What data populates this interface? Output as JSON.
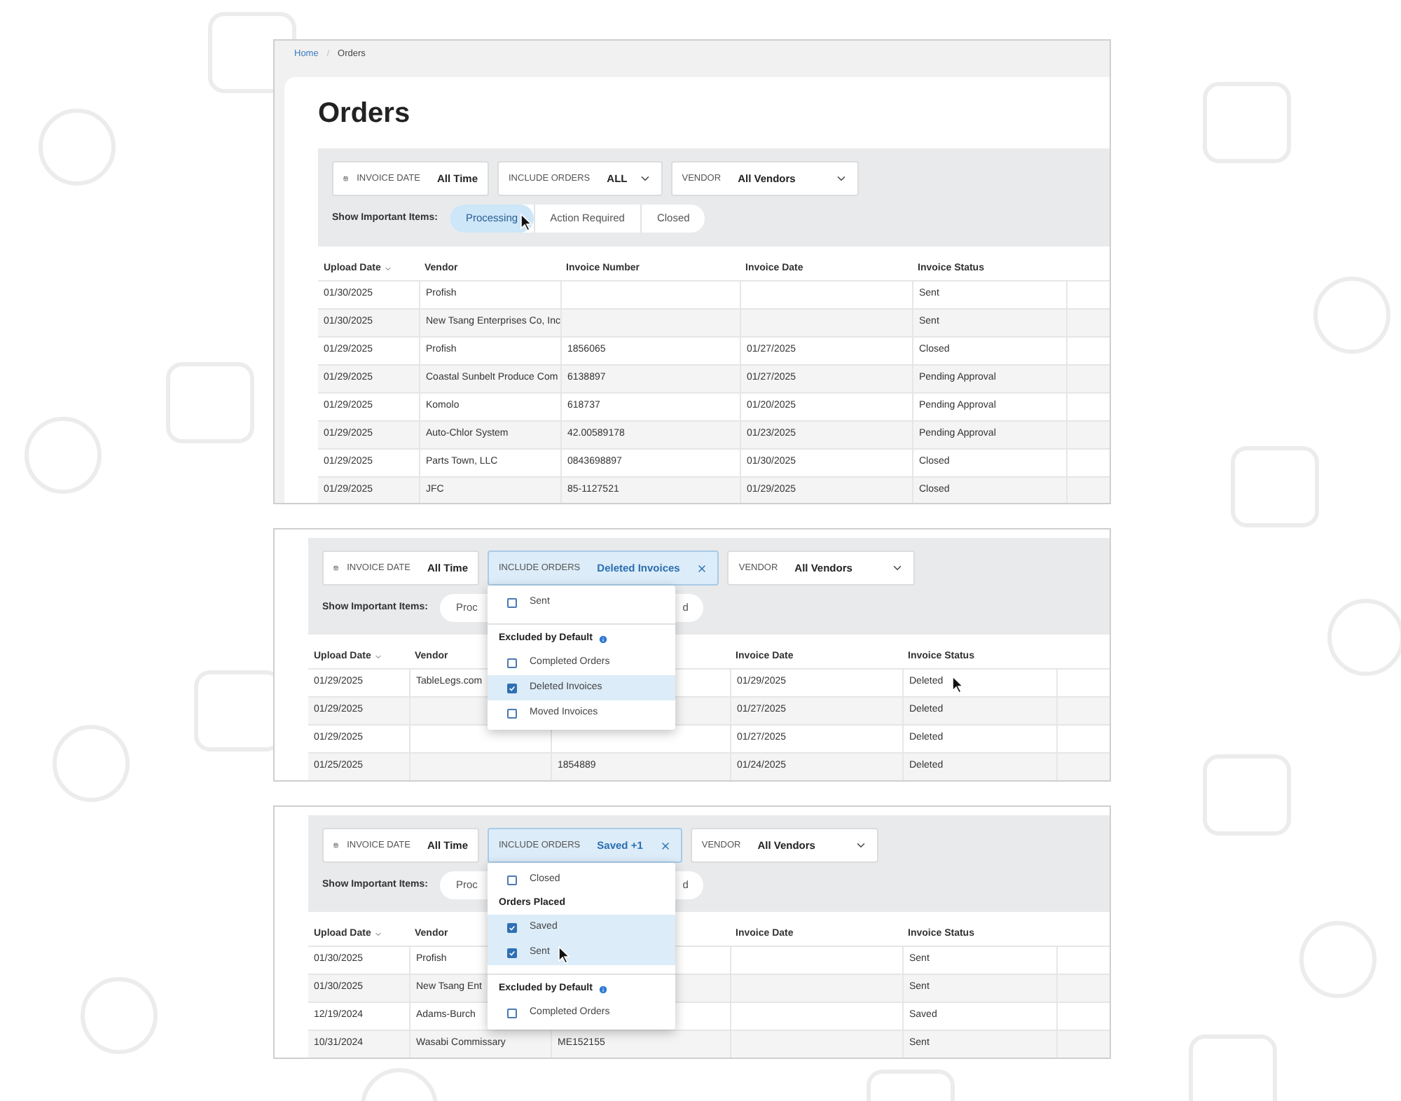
{
  "screens": [
    {
      "kind": "full",
      "breadcrumb": [
        "Home",
        "Orders"
      ],
      "breadcrumb_separator": "/",
      "title": "Orders",
      "filters": {
        "invoice_date": {
          "label": "INVOICE DATE",
          "value": "All Time"
        },
        "include_orders": {
          "label": "INCLUDE ORDERS",
          "value": "ALL",
          "active": false
        },
        "vendor": {
          "label": "VENDOR",
          "value": "All Vendors"
        }
      },
      "important_items": {
        "label": "Show Important Items:",
        "options": [
          {
            "label": "Processing",
            "selected": true,
            "pointer": true
          },
          {
            "label": "Action Required",
            "selected": false
          },
          {
            "label": "Closed",
            "selected": false
          }
        ]
      },
      "columns": {
        "upload_date": "Upload Date",
        "vendor": "Vendor",
        "invoice_number": "Invoice Number",
        "invoice_date": "Invoice Date",
        "invoice_status": "Invoice Status"
      },
      "rows": [
        {
          "upload_date": "01/30/2025",
          "vendor": "Profish",
          "invoice_status": "Sent"
        },
        {
          "upload_date": "01/30/2025",
          "vendor": "New Tsang Enterprises Co, Inc",
          "invoice_status": "Sent"
        },
        {
          "upload_date": "01/29/2025",
          "vendor": "Profish",
          "invoice_number": "1856065",
          "invoice_date": "01/27/2025",
          "invoice_status": "Closed"
        },
        {
          "upload_date": "01/29/2025",
          "vendor": "Coastal Sunbelt Produce Com",
          "invoice_number": "6138897",
          "invoice_date": "01/27/2025",
          "invoice_status": "Pending Approval"
        },
        {
          "upload_date": "01/29/2025",
          "vendor": "Komolo",
          "invoice_number": "618737",
          "invoice_date": "01/20/2025",
          "invoice_status": "Pending Approval"
        },
        {
          "upload_date": "01/29/2025",
          "vendor": "Auto-Chlor System",
          "invoice_number": "42.00589178",
          "invoice_date": "01/23/2025",
          "invoice_status": "Pending Approval"
        },
        {
          "upload_date": "01/29/2025",
          "vendor": "Parts Town, LLC",
          "invoice_number": "0843698897",
          "invoice_date": "01/30/2025",
          "invoice_status": "Closed"
        },
        {
          "upload_date": "01/29/2025",
          "vendor": "JFC",
          "invoice_number": "85-1127521",
          "invoice_date": "01/29/2025",
          "invoice_status": "Closed"
        }
      ]
    },
    {
      "kind": "dropdown",
      "filters": {
        "invoice_date": {
          "label": "INVOICE DATE",
          "value": "All Time"
        },
        "include_orders": {
          "label": "INCLUDE ORDERS",
          "value": "Deleted Invoices",
          "active": true
        },
        "vendor": {
          "label": "VENDOR",
          "value": "All Vendors"
        }
      },
      "important_items": {
        "label": "Show Important Items:",
        "options": [
          {
            "label": "Proc",
            "selected": false
          },
          {
            "label": "d",
            "selected": false
          }
        ]
      },
      "dropdown": {
        "sections": [
          {
            "options": [
              {
                "label": "Sent",
                "checked": false
              }
            ]
          },
          {
            "divider_above": true,
            "heading": "Excluded by Default",
            "info": true,
            "options": [
              {
                "label": "Completed Orders",
                "checked": false
              },
              {
                "label": "Deleted Invoices",
                "checked": true
              },
              {
                "label": "Moved Invoices",
                "checked": false
              }
            ]
          }
        ]
      },
      "columns": {
        "upload_date": "Upload Date",
        "vendor": "Vendor",
        "invoice_date": "Invoice Date",
        "invoice_status": "Invoice Status"
      },
      "rows": [
        {
          "upload_date": "01/29/2025",
          "vendor": "TableLegs.com",
          "invoice_date": "01/29/2025",
          "invoice_status": "Deleted",
          "pointer": true
        },
        {
          "upload_date": "01/29/2025",
          "invoice_date": "01/27/2025",
          "invoice_status": "Deleted"
        },
        {
          "upload_date": "01/29/2025",
          "invoice_date": "01/27/2025",
          "invoice_status": "Deleted"
        },
        {
          "upload_date": "01/25/2025",
          "invoice_number": "1854889",
          "invoice_date": "01/24/2025",
          "invoice_status": "Deleted"
        }
      ]
    },
    {
      "kind": "dropdown",
      "filters": {
        "invoice_date": {
          "label": "INVOICE DATE",
          "value": "All Time"
        },
        "include_orders": {
          "label": "INCLUDE ORDERS",
          "value": "Saved +1",
          "active": true
        },
        "vendor": {
          "label": "VENDOR",
          "value": "All Vendors"
        }
      },
      "important_items": {
        "label": "Show Important Items:",
        "options": [
          {
            "label": "Proc",
            "selected": false
          },
          {
            "label": "d",
            "selected": false
          }
        ]
      },
      "dropdown": {
        "sections": [
          {
            "options": [
              {
                "label": "Closed",
                "checked": false
              }
            ]
          },
          {
            "heading": "Orders Placed",
            "options": [
              {
                "label": "Saved",
                "checked": true
              },
              {
                "label": "Sent",
                "checked": true,
                "pointer": true
              }
            ]
          },
          {
            "divider_above": true,
            "heading": "Excluded by Default",
            "info": true,
            "options": [
              {
                "label": "Completed Orders",
                "checked": false
              }
            ]
          }
        ]
      },
      "columns": {
        "upload_date": "Upload Date",
        "vendor": "Vendor",
        "invoice_date": "Invoice Date",
        "invoice_status": "Invoice Status"
      },
      "rows": [
        {
          "upload_date": "01/30/2025",
          "vendor": "Profish",
          "invoice_status": "Sent"
        },
        {
          "upload_date": "01/30/2025",
          "vendor": "New Tsang Ent",
          "invoice_status": "Sent"
        },
        {
          "upload_date": "12/19/2024",
          "vendor": "Adams-Burch",
          "invoice_status": "Saved"
        },
        {
          "upload_date": "10/31/2024",
          "vendor": "Wasabi Commissary",
          "invoice_number": "ME152155",
          "invoice_status": "Sent"
        }
      ]
    }
  ]
}
